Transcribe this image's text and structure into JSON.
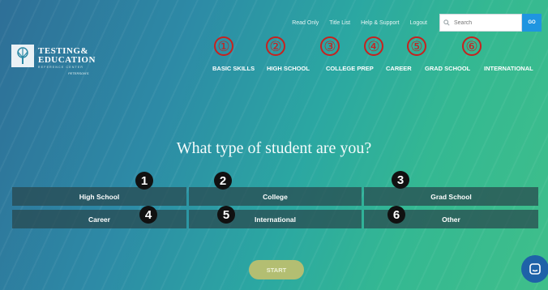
{
  "topbar": {
    "links": [
      "Read Only",
      "Title List",
      "Help & Support",
      "Logout"
    ],
    "search_placeholder": "Search",
    "search_value": "",
    "go_label": "GO"
  },
  "logo": {
    "line1": "TESTING&",
    "line2": "EDUCATION",
    "line3": "REFERENCE CENTER",
    "line4": "PETERSON'S"
  },
  "nav": {
    "items": [
      "BASIC SKILLS",
      "HIGH SCHOOL",
      "COLLEGE PREP",
      "CAREER",
      "GRAD SCHOOL",
      "INTERNATIONAL"
    ],
    "annotation_numbers": [
      "①",
      "②",
      "③",
      "④",
      "⑤",
      "⑥"
    ]
  },
  "main": {
    "headline": "What type of student are you?",
    "options": [
      "High School",
      "College",
      "Grad School",
      "Career",
      "International",
      "Other"
    ],
    "annotation_numbers": [
      "1",
      "2",
      "3",
      "4",
      "5",
      "6"
    ],
    "start_label": "START"
  },
  "colors": {
    "annotation_red": "#c8211e",
    "option_bg": "#28464c",
    "start_bg": "#b3be72",
    "go_bg": "#1f95e0",
    "chat_bg": "#1e62a8"
  },
  "icons": {
    "search": "search-icon",
    "chat": "chat-icon",
    "logo": "tree-logo-icon"
  }
}
